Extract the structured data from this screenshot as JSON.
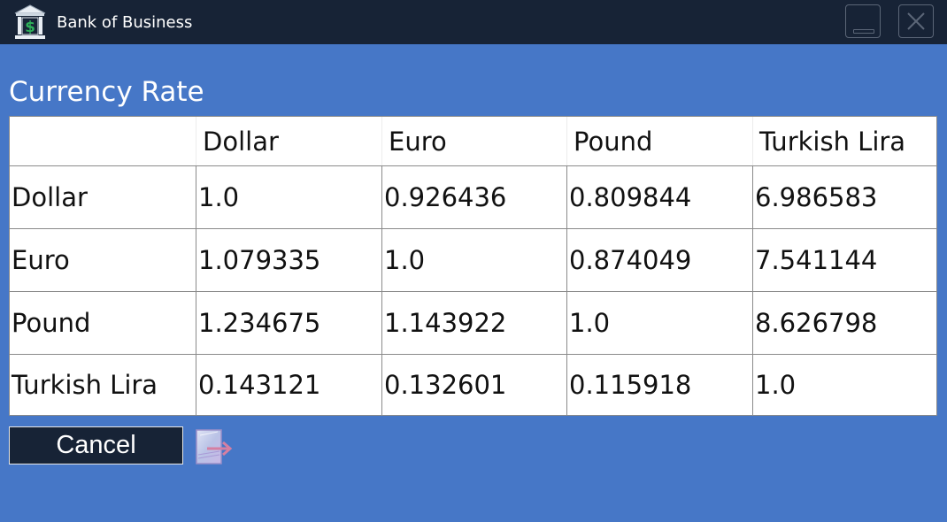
{
  "window": {
    "title": "Bank of Business",
    "icons": {
      "app": "bank-dollar-icon",
      "minimize": "minimize-icon",
      "close": "close-icon"
    }
  },
  "page": {
    "heading": "Currency Rate"
  },
  "rates_table": {
    "columns": [
      "",
      "Dollar",
      "Euro",
      "Pound",
      "Turkish Lira"
    ],
    "rows": [
      [
        "Dollar",
        "1.0",
        "0.926436",
        "0.809844",
        "6.986583"
      ],
      [
        "Euro",
        "1.079335",
        "1.0",
        "0.874049",
        "7.541144"
      ],
      [
        "Pound",
        "1.234675",
        "1.143922",
        "1.0",
        "8.626798"
      ],
      [
        "Turkish Lira",
        "0.143121",
        "0.132601",
        "0.115918",
        "1.0"
      ]
    ]
  },
  "footer": {
    "cancel_label": "Cancel",
    "exit_icon": "exit-arrow-icon"
  },
  "colors": {
    "background": "#4677c7",
    "titlebar": "#172336",
    "table_bg": "#ffffff",
    "button_bg": "#172336",
    "accent_green": "#2fb05a"
  }
}
